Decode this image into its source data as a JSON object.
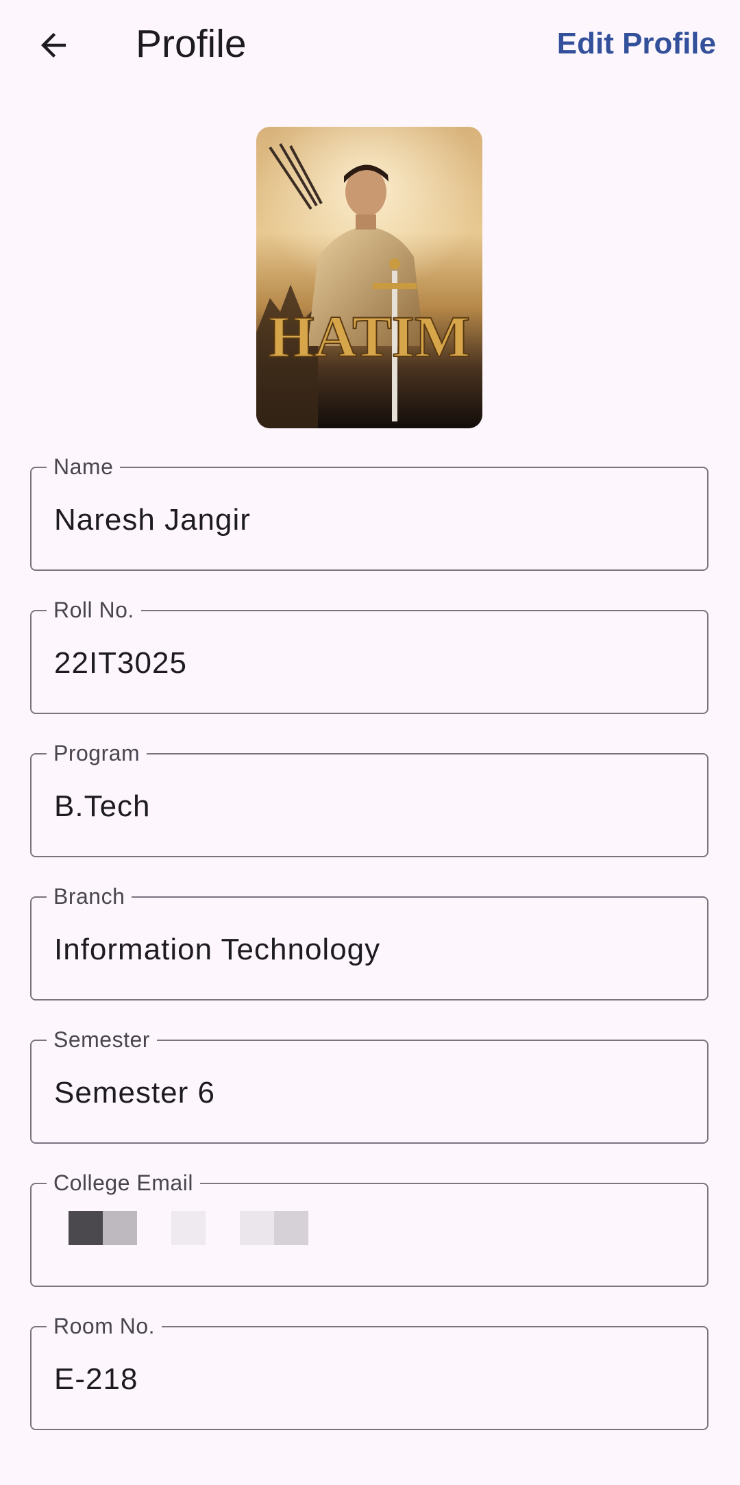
{
  "header": {
    "title": "Profile",
    "edit_label": "Edit Profile",
    "back_icon": "arrow-back-icon"
  },
  "avatar": {
    "poster_text": "HATIM",
    "colors": {
      "sky": "#c89a55",
      "dark": "#1a140f",
      "gold": "#d8a64a"
    }
  },
  "fields": [
    {
      "label": "Name",
      "value": "Naresh Jangir"
    },
    {
      "label": "Roll No.",
      "value": "22IT3025"
    },
    {
      "label": "Program",
      "value": "B.Tech"
    },
    {
      "label": "Branch",
      "value": "Information Technology"
    },
    {
      "label": "Semester",
      "value": "Semester 6"
    },
    {
      "label": "College Email",
      "value": ""
    },
    {
      "label": "Room No.",
      "value": "E-218"
    }
  ],
  "theme": {
    "background": "#fdf7fd",
    "accent": "#33509a",
    "outline": "#79747e"
  }
}
